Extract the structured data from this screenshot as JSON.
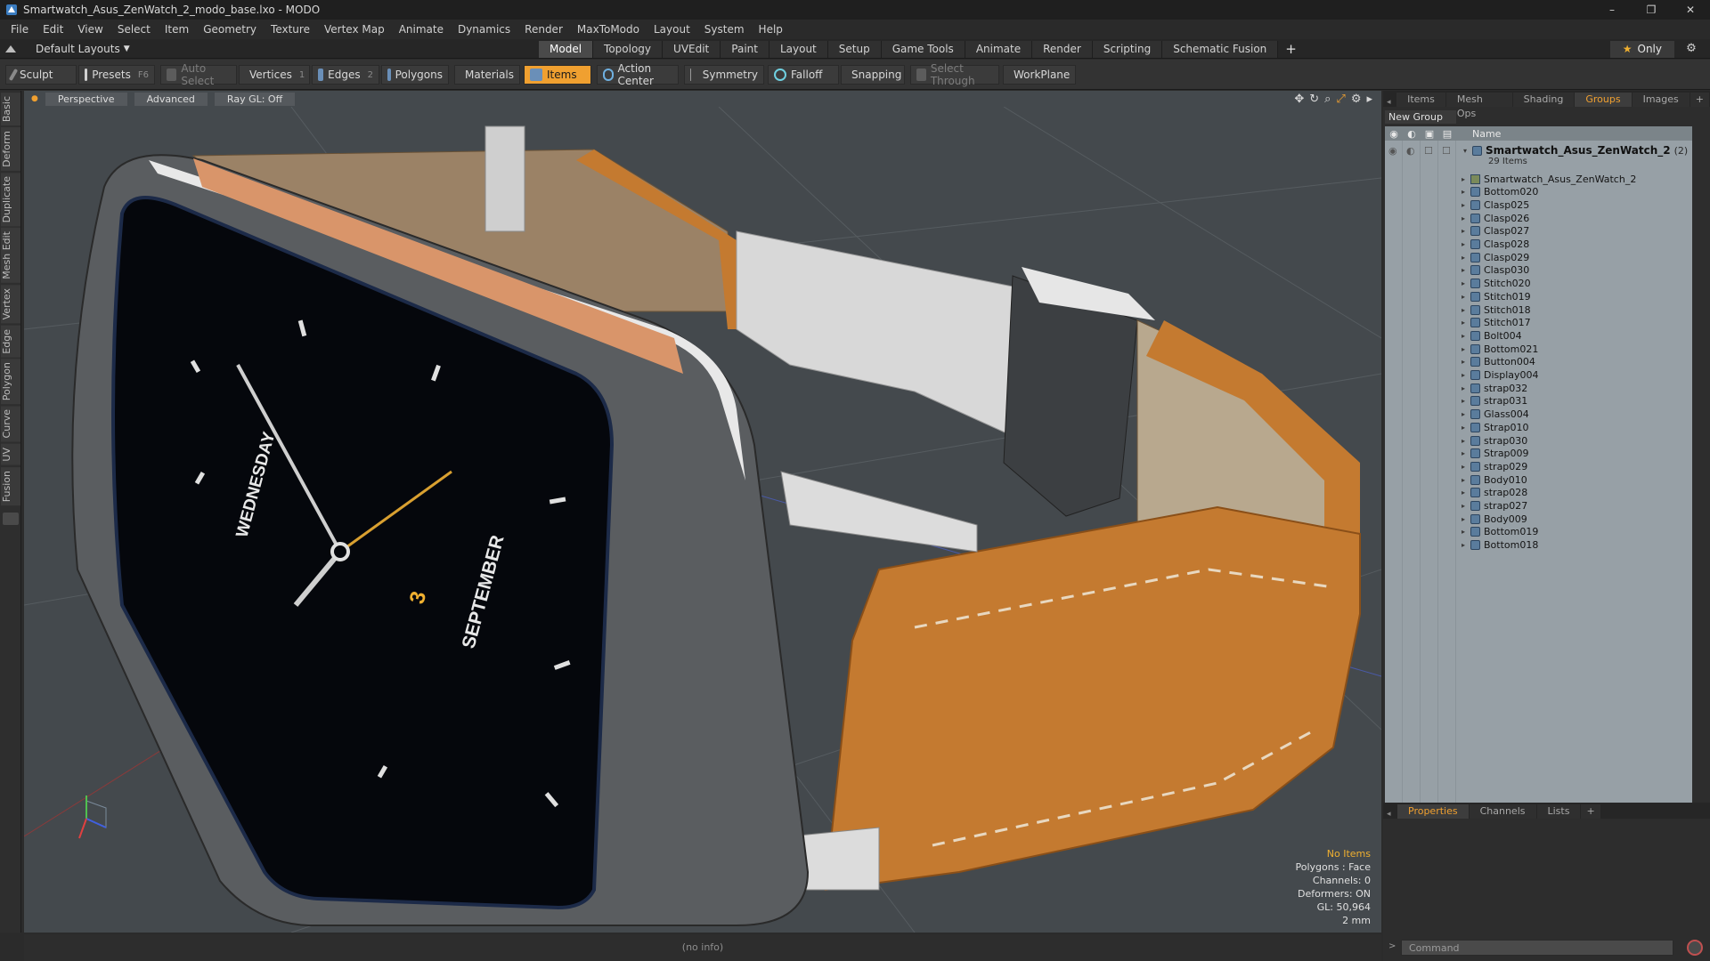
{
  "window": {
    "title": "Smartwatch_Asus_ZenWatch_2_modo_base.lxo - MODO",
    "min": "–",
    "max": "❐",
    "close": "✕"
  },
  "menu": [
    "File",
    "Edit",
    "View",
    "Select",
    "Item",
    "Geometry",
    "Texture",
    "Vertex Map",
    "Animate",
    "Dynamics",
    "Render",
    "MaxToModo",
    "Layout",
    "System",
    "Help"
  ],
  "modebar": {
    "layout": "Default Layouts",
    "tabs": [
      "Model",
      "Topology",
      "UVEdit",
      "Paint",
      "Layout",
      "Setup",
      "Game Tools",
      "Animate",
      "Render",
      "Scripting",
      "Schematic Fusion"
    ],
    "active_tab": "Model",
    "plus": "+",
    "only": "Only"
  },
  "toolbar": {
    "sculpt": "Sculpt",
    "presets": "Presets",
    "presets_key": "F6",
    "auto_select": "Auto Select",
    "vertices": "Vertices",
    "vertices_key": "1",
    "edges": "Edges",
    "edges_key": "2",
    "polygons": "Polygons",
    "materials": "Materials",
    "items": "Items",
    "action_center": "Action Center",
    "symmetry": "Symmetry",
    "falloff": "Falloff",
    "snapping": "Snapping",
    "select_through": "Select Through",
    "workplane": "WorkPlane"
  },
  "left_tabs": [
    "Basic",
    "Deform",
    "Duplicate",
    "Mesh Edit",
    "Vertex",
    "Edge",
    "Polygon",
    "Curve",
    "UV",
    "Fusion"
  ],
  "viewport": {
    "perspective": "Perspective",
    "advanced": "Advanced",
    "raygl": "Ray GL: Off",
    "info": {
      "items": "No Items",
      "polygons": "Polygons : Face",
      "channels": "Channels: 0",
      "deformers": "Deformers: ON",
      "gl": "GL: 50,964",
      "scale": "2 mm"
    },
    "watch_face": {
      "day": "WEDNESDAY",
      "date": "3",
      "month": "SEPTEMBER"
    },
    "colors": {
      "background": "#44494d",
      "leather": "#c47a30",
      "accent": "#f0a030"
    }
  },
  "status": "(no info)",
  "right_panel": {
    "tabs": [
      "Items",
      "Mesh Ops",
      "Shading",
      "Groups",
      "Images"
    ],
    "active_tab": "Groups",
    "plus": "+",
    "new_group": "New Group",
    "col_name": "Name",
    "root": {
      "name": "Smartwatch_Asus_ZenWatch_2",
      "count": "(2)",
      "sub": "29 Items"
    },
    "items": [
      "Smartwatch_Asus_ZenWatch_2",
      "Bottom020",
      "Clasp025",
      "Clasp026",
      "Clasp027",
      "Clasp028",
      "Clasp029",
      "Clasp030",
      "Stitch020",
      "Stitch019",
      "Stitch018",
      "Stitch017",
      "Bolt004",
      "Bottom021",
      "Button004",
      "Display004",
      "strap032",
      "strap031",
      "Glass004",
      "Strap010",
      "strap030",
      "Strap009",
      "strap029",
      "Body010",
      "strap028",
      "strap027",
      "Body009",
      "Bottom019",
      "Bottom018"
    ],
    "bottom_tabs": [
      "Properties",
      "Channels",
      "Lists"
    ],
    "bottom_active": "Properties",
    "command_placeholder": "Command"
  }
}
